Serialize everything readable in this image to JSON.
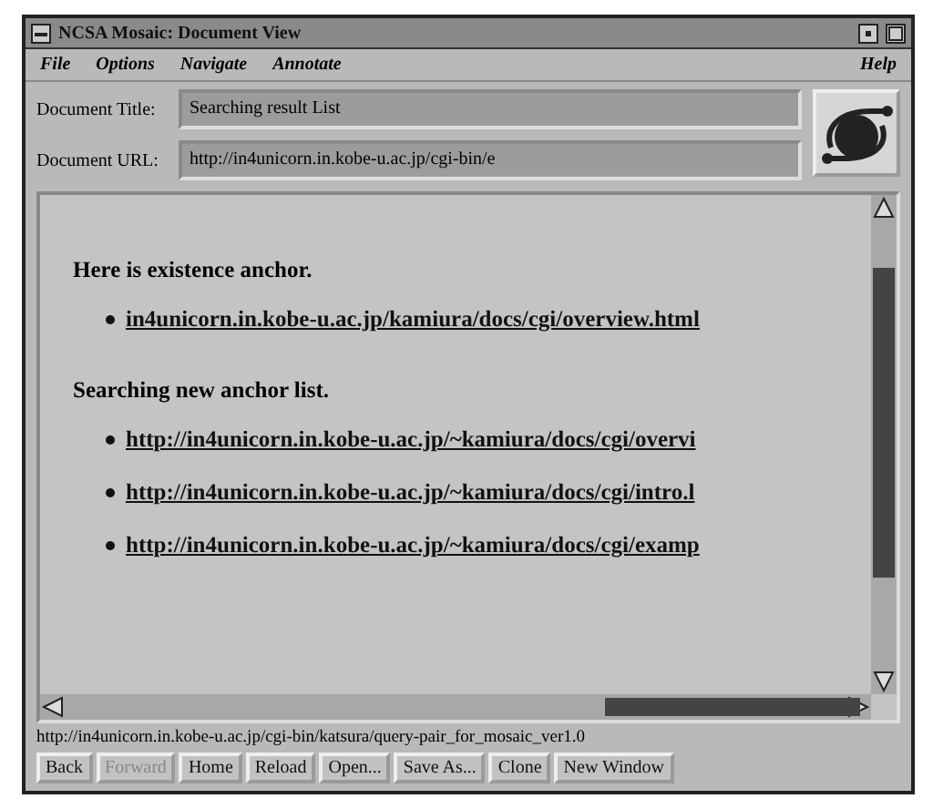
{
  "window": {
    "title": "NCSA Mosaic: Document View"
  },
  "menu": [
    "File",
    "Options",
    "Navigate",
    "Annotate"
  ],
  "help_menu": "Help",
  "fields": [
    {
      "label": "Document Title:",
      "value": "Searching result List"
    },
    {
      "label": "Document URL:",
      "value": "http://in4unicorn.in.kobe-u.ac.jp/cgi-bin/e"
    }
  ],
  "content": [
    {
      "kind": "heading",
      "text": "Here is existence anchor."
    },
    {
      "kind": "link",
      "text": "in4unicorn.in.kobe-u.ac.jp/kamiura/docs/cgi/overview.html"
    },
    {
      "kind": "heading",
      "text": "Searching new anchor list."
    },
    {
      "kind": "link",
      "text": "http://in4unicorn.in.kobe-u.ac.jp/~kamiura/docs/cgi/overvi"
    },
    {
      "kind": "link",
      "text": "http://in4unicorn.in.kobe-u.ac.jp/~kamiura/docs/cgi/intro.l"
    },
    {
      "kind": "link",
      "text": "http://in4unicorn.in.kobe-u.ac.jp/~kamiura/docs/cgi/examp"
    }
  ],
  "status_bar": "http://in4unicorn.in.kobe-u.ac.jp/cgi-bin/katsura/query-pair_for_mosaic_ver1.0",
  "buttons": [
    {
      "label": "Back",
      "disabled": false
    },
    {
      "label": "Forward",
      "disabled": true
    },
    {
      "label": "Home",
      "disabled": false
    },
    {
      "label": "Reload",
      "disabled": false
    },
    {
      "label": "Open...",
      "disabled": false
    },
    {
      "label": "Save As...",
      "disabled": false
    },
    {
      "label": "Clone",
      "disabled": false
    },
    {
      "label": "New Window",
      "disabled": false
    }
  ]
}
